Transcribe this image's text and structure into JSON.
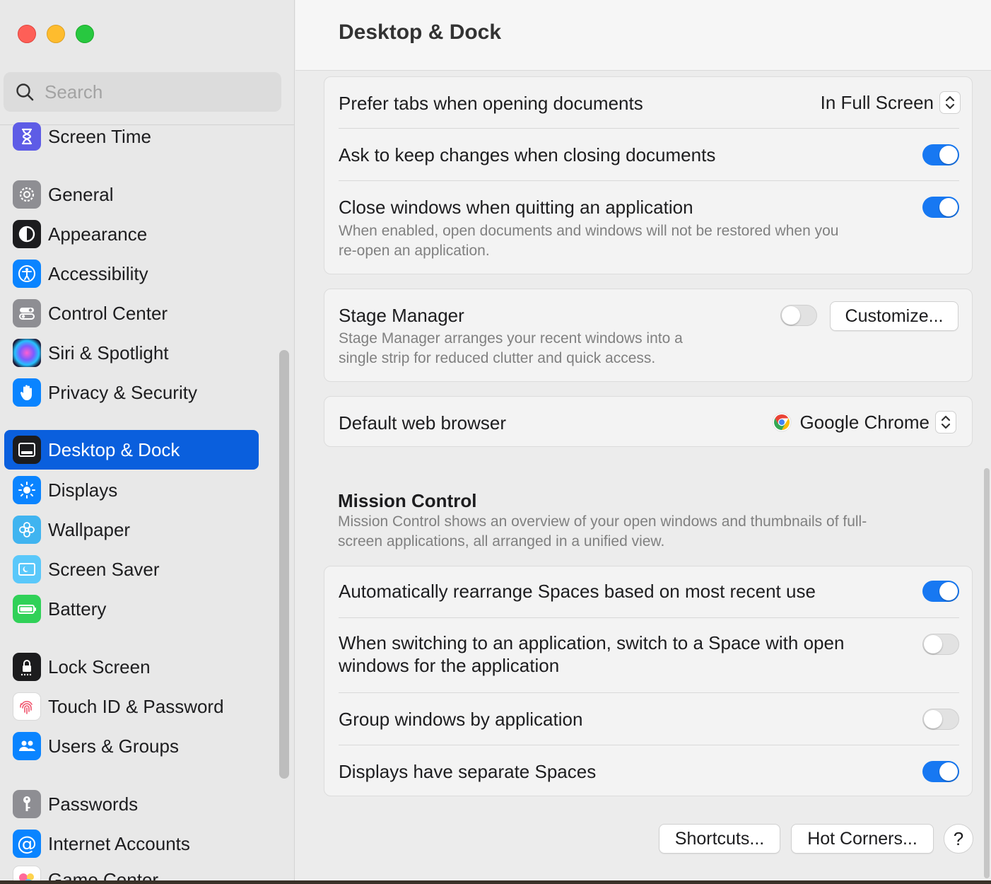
{
  "window": {
    "title": "Desktop & Dock"
  },
  "search": {
    "placeholder": "Search"
  },
  "sidebar": {
    "items": [
      {
        "label": "Screen Time",
        "icon": "hourglass-icon",
        "color": "#5e5ce6"
      },
      {
        "label": "General",
        "icon": "gear-icon",
        "color": "#8e8e93"
      },
      {
        "label": "Appearance",
        "icon": "appearance-icon",
        "color": "#1c1c1e"
      },
      {
        "label": "Accessibility",
        "icon": "accessibility-icon",
        "color": "#0a84ff"
      },
      {
        "label": "Control Center",
        "icon": "control-center-icon",
        "color": "#8e8e93"
      },
      {
        "label": "Siri & Spotlight",
        "icon": "siri-icon",
        "color": "#1c1c3a"
      },
      {
        "label": "Privacy & Security",
        "icon": "hand-icon",
        "color": "#0a84ff"
      },
      {
        "label": "Desktop & Dock",
        "icon": "dock-icon",
        "color": "#1c1c1e",
        "active": true
      },
      {
        "label": "Displays",
        "icon": "sun-icon",
        "color": "#0a84ff"
      },
      {
        "label": "Wallpaper",
        "icon": "flower-icon",
        "color": "#40b4f0"
      },
      {
        "label": "Screen Saver",
        "icon": "screen-saver-icon",
        "color": "#5ac8fa"
      },
      {
        "label": "Battery",
        "icon": "battery-icon",
        "color": "#30d158"
      },
      {
        "label": "Lock Screen",
        "icon": "lock-icon",
        "color": "#1c1c1e"
      },
      {
        "label": "Touch ID & Password",
        "icon": "fingerprint-icon",
        "color": "#ffffff"
      },
      {
        "label": "Users & Groups",
        "icon": "users-icon",
        "color": "#0a84ff"
      },
      {
        "label": "Passwords",
        "icon": "key-icon",
        "color": "#8e8e93"
      },
      {
        "label": "Internet Accounts",
        "icon": "at-icon",
        "color": "#0a84ff"
      },
      {
        "label": "Game Center",
        "icon": "game-center-icon",
        "color": "#ffffff"
      }
    ]
  },
  "windows_card": {
    "prefer_tabs": {
      "label": "Prefer tabs when opening documents",
      "value": "In Full Screen"
    },
    "ask_keep_changes": {
      "label": "Ask to keep changes when closing documents",
      "on": true
    },
    "close_windows": {
      "label": "Close windows when quitting an application",
      "description_line1": "When enabled, open documents and windows will not be restored when you",
      "description_line2": "re-open an application.",
      "on": true
    }
  },
  "stage_manager": {
    "label": "Stage Manager",
    "description_line1": "Stage Manager arranges your recent windows into a",
    "description_line2": "single strip for reduced clutter and quick access.",
    "on": false,
    "customize_label": "Customize..."
  },
  "default_browser": {
    "label": "Default web browser",
    "value": "Google Chrome",
    "icon": "chrome-icon"
  },
  "mission_control": {
    "title": "Mission Control",
    "description_line1": "Mission Control shows an overview of your open windows and thumbnails of full-",
    "description_line2": "screen applications, all arranged in a unified view.",
    "rearrange_spaces": {
      "label": "Automatically rearrange Spaces based on most recent use",
      "on": true
    },
    "switch_space": {
      "label_line1": "When switching to an application, switch to a Space with open",
      "label_line2": "windows for the application",
      "on": false
    },
    "group_windows": {
      "label": "Group windows by application",
      "on": false
    },
    "separate_spaces": {
      "label": "Displays have separate Spaces",
      "on": true
    }
  },
  "footer": {
    "shortcuts_label": "Shortcuts...",
    "hot_corners_label": "Hot Corners...",
    "help_label": "?"
  },
  "colors": {
    "accent": "#1778f2",
    "sidebar_selection": "#0a5fdd"
  }
}
